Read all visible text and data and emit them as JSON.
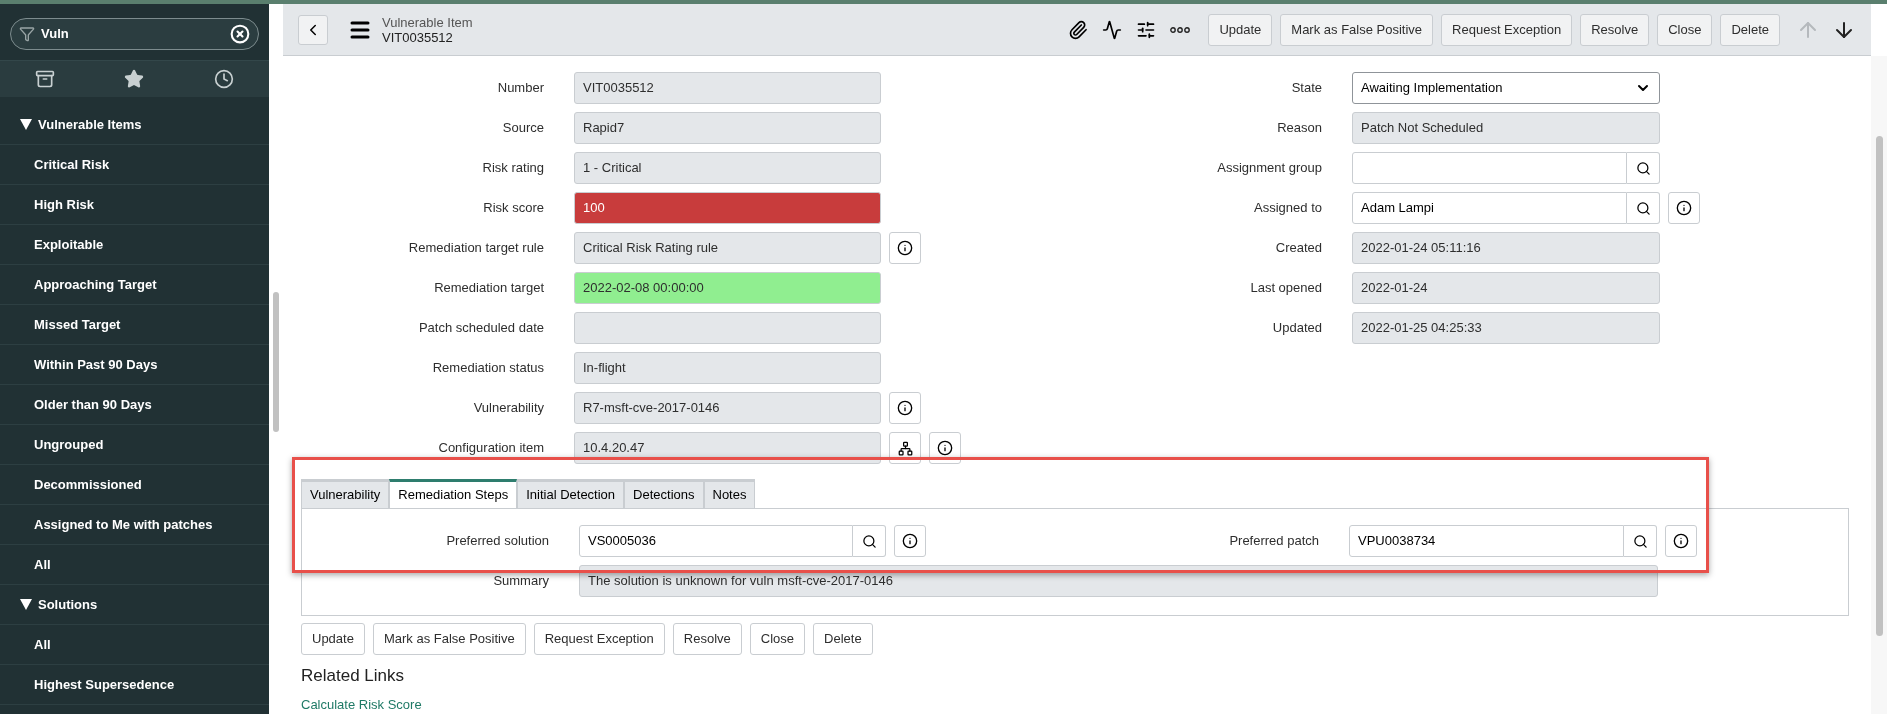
{
  "sidebar": {
    "search": {
      "value": "Vuln"
    },
    "sections": [
      {
        "label": "Vulnerable Items",
        "expanded": true,
        "items": [
          "Critical Risk",
          "High Risk",
          "Exploitable",
          "Approaching Target",
          "Missed Target",
          "Within Past 90 Days",
          "Older than 90 Days",
          "Ungrouped",
          "Decommissioned",
          "Assigned to Me with patches",
          "All"
        ]
      },
      {
        "label": "Solutions",
        "expanded": true,
        "items": [
          "All",
          "Highest Supersedence"
        ]
      }
    ]
  },
  "header": {
    "title": "Vulnerable Item",
    "subtitle": "VIT0035512",
    "buttons": [
      "Update",
      "Mark as False Positive",
      "Request Exception",
      "Resolve",
      "Close",
      "Delete"
    ],
    "nav": [
      {
        "kind": "up",
        "disabled": true
      },
      {
        "kind": "down",
        "disabled": false
      }
    ]
  },
  "form": {
    "left": [
      {
        "label": "Number",
        "value": "VIT0035512",
        "kind": "readonly",
        "hierarchy": false,
        "info": false
      },
      {
        "label": "Source",
        "value": "Rapid7",
        "kind": "readonly",
        "hierarchy": false,
        "info": false
      },
      {
        "label": "Risk rating",
        "value": "1 - Critical",
        "kind": "readonly",
        "hierarchy": false,
        "info": false
      },
      {
        "label": "Risk score",
        "value": "100",
        "kind": "readonly",
        "color": "#c83c3c",
        "hierarchy": false,
        "info": false
      },
      {
        "label": "Remediation target rule",
        "value": "Critical Risk Rating rule",
        "kind": "readonly",
        "hierarchy": false,
        "info": true
      },
      {
        "label": "Remediation target",
        "value": "2022-02-08 00:00:00",
        "kind": "readonly",
        "color": "#90ee90",
        "hierarchy": false,
        "info": false
      },
      {
        "label": "Patch scheduled date",
        "kind": "readonly",
        "hierarchy": false,
        "info": false
      },
      {
        "label": "Remediation status",
        "value": "In-flight",
        "kind": "readonly",
        "hierarchy": false,
        "info": false
      },
      {
        "label": "Vulnerability",
        "value": "R7-msft-cve-2017-0146",
        "kind": "readonly",
        "hierarchy": false,
        "info": true
      },
      {
        "label": "Configuration item",
        "value": "10.4.20.47",
        "kind": "readonly",
        "hierarchy": true,
        "info": true
      }
    ],
    "right": [
      {
        "label": "State",
        "value": "Awaiting Implementation",
        "kind": "select",
        "hierarchy": false,
        "info": false
      },
      {
        "label": "Reason",
        "value": "Patch Not Scheduled",
        "kind": "readonly",
        "hierarchy": false,
        "info": false
      },
      {
        "label": "Assignment group",
        "kind": "reference",
        "hierarchy": false,
        "info": false
      },
      {
        "label": "Assigned to",
        "value": "Adam Lampi",
        "kind": "reference",
        "hierarchy": false,
        "info": true
      },
      {
        "label": "Created",
        "value": "2022-01-24 05:11:16",
        "kind": "readonly",
        "hierarchy": false,
        "info": false
      },
      {
        "label": "Last opened",
        "value": "2022-01-24",
        "kind": "readonly",
        "hierarchy": false,
        "info": false
      },
      {
        "label": "Updated",
        "value": "2022-01-25 04:25:33",
        "kind": "readonly",
        "hierarchy": false,
        "info": false
      }
    ]
  },
  "tabs": [
    {
      "label": "Vulnerability",
      "selected": false
    },
    {
      "label": "Remediation Steps",
      "selected": true
    },
    {
      "label": "Initial Detection",
      "selected": false
    },
    {
      "label": "Detections",
      "selected": false
    },
    {
      "label": "Notes",
      "selected": false
    }
  ],
  "tab_panel": {
    "left": [
      {
        "label": "Preferred solution",
        "value": "VS0005036",
        "kind": "reference",
        "hierarchy": false,
        "info": true
      }
    ],
    "right": [
      {
        "label": "Preferred patch",
        "value": "VPU0038734",
        "kind": "reference",
        "hierarchy": false,
        "info": true
      }
    ],
    "summary": {
      "label": "Summary",
      "value": "The solution is unknown for vuln msft-cve-2017-0146",
      "kind": "readonly",
      "hierarchy": false,
      "info": false
    }
  },
  "footer_buttons": [
    "Update",
    "Mark as False Positive",
    "Request Exception",
    "Resolve",
    "Close",
    "Delete"
  ],
  "related_links": {
    "title": "Related Links",
    "links": [
      "Calculate Risk Score"
    ]
  }
}
